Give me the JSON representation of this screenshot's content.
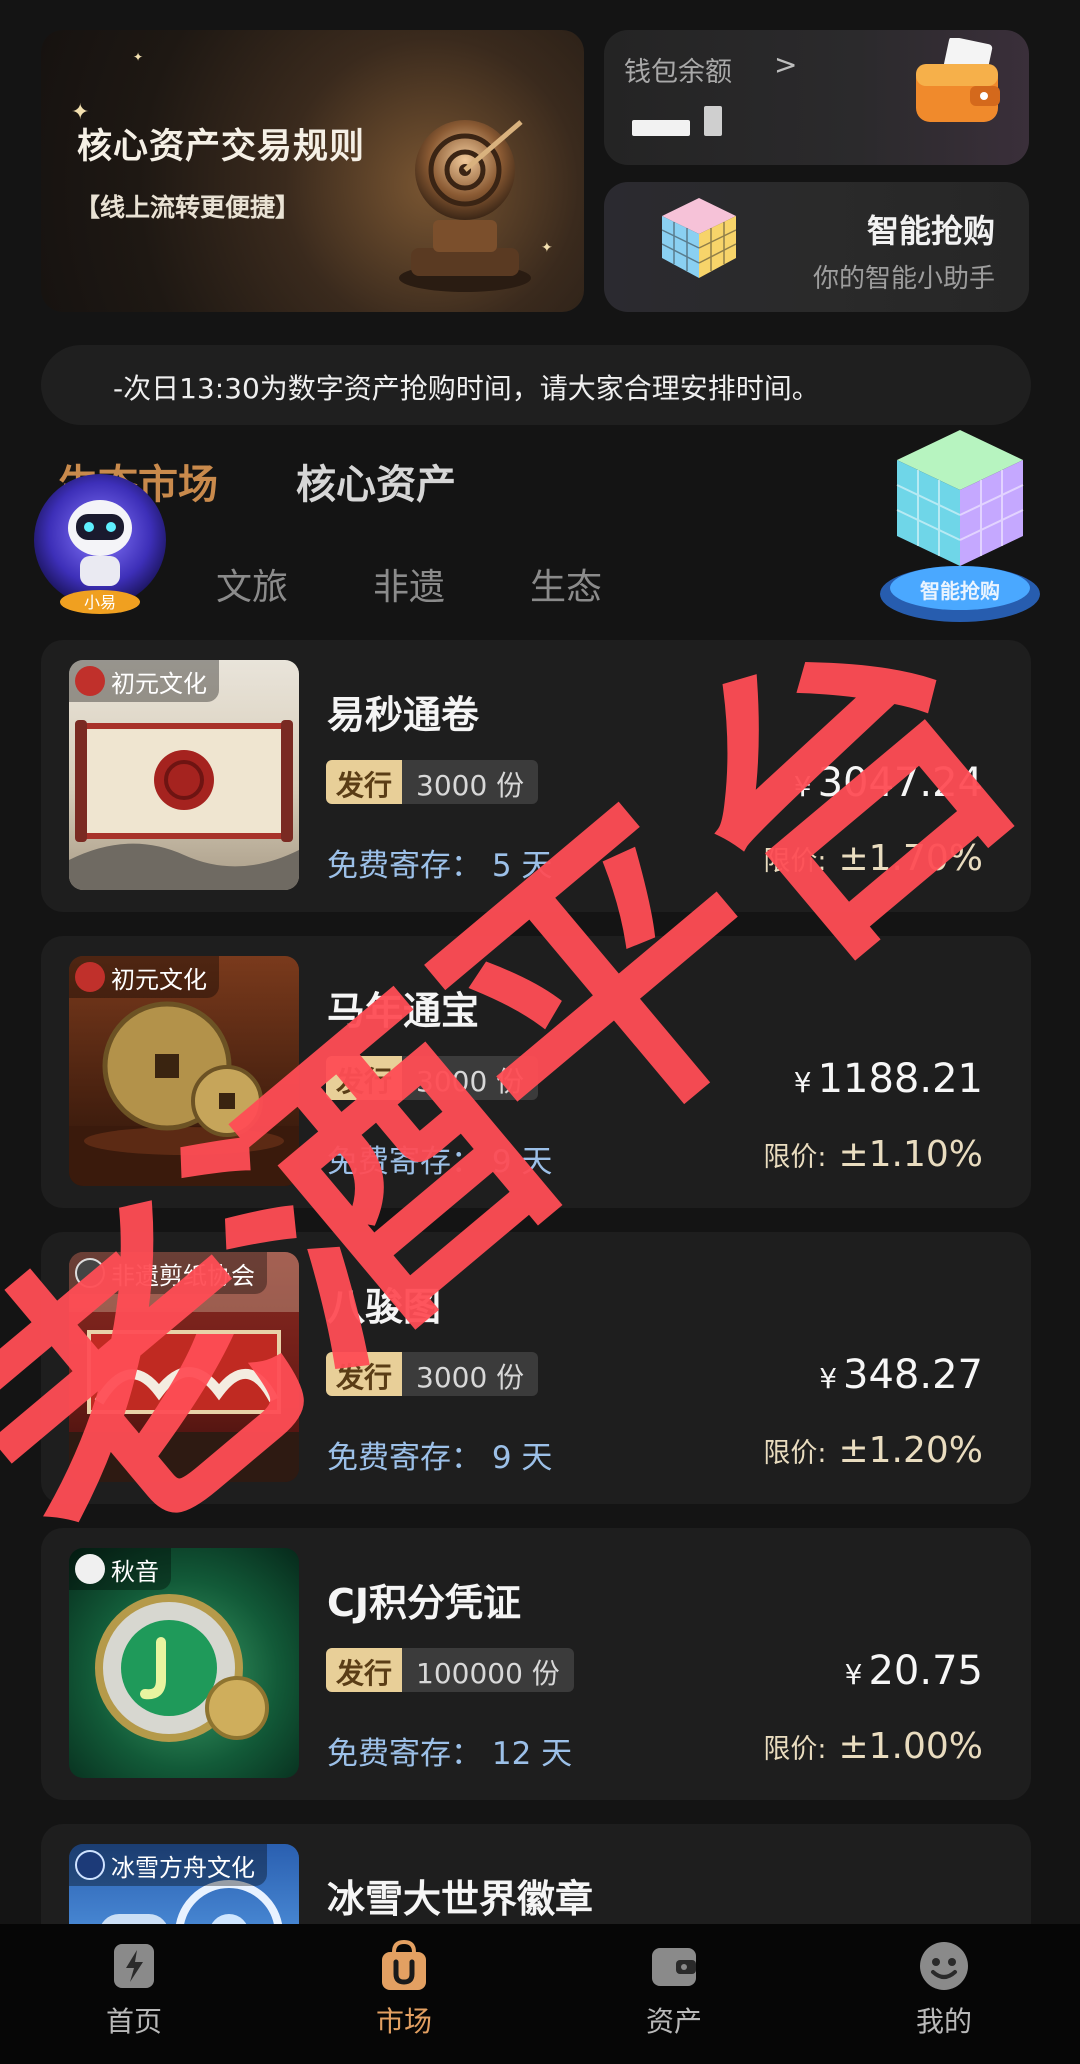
{
  "banner": {
    "rules_title": "核心资产交易规则",
    "rules_subtitle": "【线上流转更便捷】",
    "wallet_label": "钱包余额",
    "wallet_chevron": ">",
    "smart_title": "智能抢购",
    "smart_subtitle": "你的智能小助手"
  },
  "notice": {
    "text": "-次日13:30为数字资产抢购时间，请大家合理安排时间。"
  },
  "tabs": {
    "main": [
      "生态市场",
      "核心资产"
    ],
    "categories": [
      "文旅",
      "非遗",
      "生态"
    ],
    "robot_label": "小易",
    "big_cube_label": "智能抢购"
  },
  "products": [
    {
      "brand": "初元文化",
      "title": "易秒通卷",
      "issue_tag": "发行",
      "issue_value": "3000 份",
      "storage": "免费寄存：  5 天",
      "price": "3047.24",
      "limit_label": "限价:",
      "limit_value": "±1.70%"
    },
    {
      "brand": "初元文化",
      "title": "马年通宝",
      "issue_tag": "发行",
      "issue_value": "3000 份",
      "storage": "免费寄存：  9 天",
      "price": "1188.21",
      "limit_label": "限价:",
      "limit_value": "±1.10%"
    },
    {
      "brand": "非遗剪纸协会",
      "title": "八骏图",
      "issue_tag": "发行",
      "issue_value": "3000 份",
      "storage": "免费寄存：  9 天",
      "price": "348.27",
      "limit_label": "限价:",
      "limit_value": "±1.20%"
    },
    {
      "brand": "秋音",
      "title": "CJ积分凭证",
      "issue_tag": "发行",
      "issue_value": "100000 份",
      "storage": "免费寄存：  12 天",
      "price": "20.75",
      "limit_label": "限价:",
      "limit_value": "±1.00%"
    },
    {
      "brand": "冰雪方舟文化",
      "title": "冰雪大世界徽章"
    }
  ],
  "currency_symbol": "¥",
  "watermark_text": "老酒平台",
  "nav": {
    "items": [
      "首页",
      "市场",
      "资产",
      "我的"
    ],
    "active": "市场"
  },
  "colors": {
    "background": "#141414",
    "card": "#1e1e1e",
    "accent_orange": "#e3a062",
    "issue_tag": "#e8cf98",
    "storage_blue": "#9cc0e8",
    "watermark_red": "#ff4d55"
  }
}
